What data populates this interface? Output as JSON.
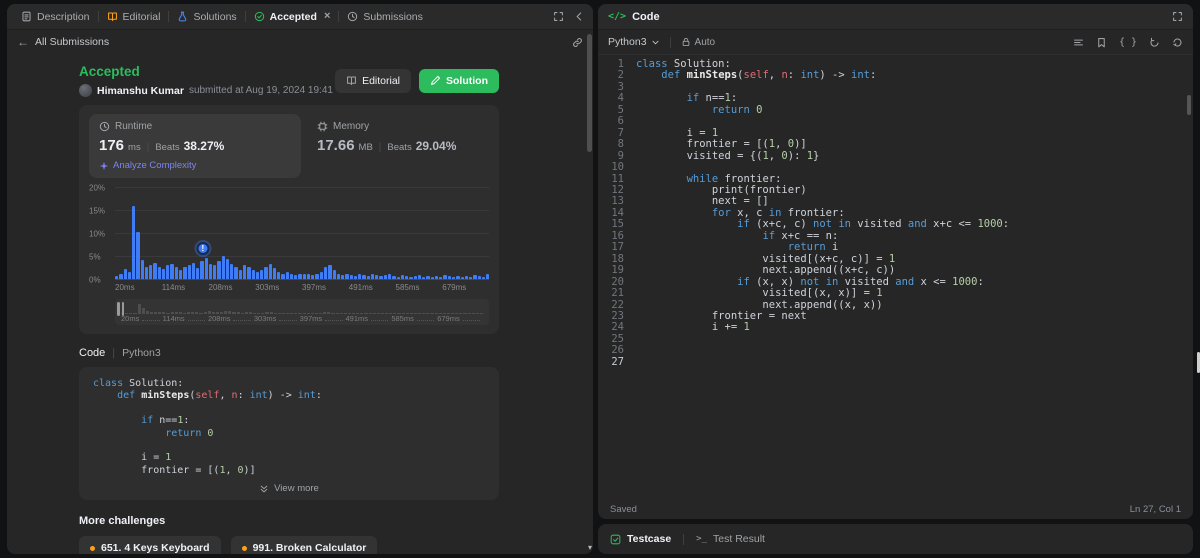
{
  "colors": {
    "accent_green": "#2cbb5d",
    "accent_blue": "#3f7cf6",
    "accent_orange": "#ffa116",
    "analyze_link": "#7c83f7",
    "panel_bg": "#262626"
  },
  "left_panel": {
    "tabs": [
      {
        "label": "Description"
      },
      {
        "label": "Editorial"
      },
      {
        "label": "Solutions"
      },
      {
        "label": "Accepted"
      },
      {
        "label": "Submissions"
      }
    ],
    "back_label": "All Submissions",
    "result": {
      "status": "Accepted",
      "author": "Himanshu Kumar",
      "submitted_at": "submitted at Aug 19, 2024 19:41",
      "editorial_button": "Editorial",
      "solution_button": "Solution"
    },
    "stats": {
      "runtime_label": "Runtime",
      "runtime_value": "176",
      "runtime_unit": "ms",
      "beats_label": "Beats",
      "runtime_beats": "38.27%",
      "analyze_link": "Analyze Complexity",
      "memory_label": "Memory",
      "memory_value": "17.66",
      "memory_unit": "MB",
      "memory_beats": "29.04%"
    },
    "code_section": {
      "label": "Code",
      "lang": "Python3",
      "view_more": "View more"
    },
    "preview_lines": [
      [
        [
          "k",
          "class"
        ],
        [
          "p",
          " Solution:"
        ]
      ],
      [
        [
          "p",
          "    "
        ],
        [
          "k",
          "def"
        ],
        [
          "p",
          " "
        ],
        [
          "d",
          "minSteps"
        ],
        [
          "p",
          "("
        ],
        [
          "s",
          "self"
        ],
        [
          "p",
          ", "
        ],
        [
          "s",
          "n"
        ],
        [
          "p",
          ": "
        ],
        [
          "k",
          "int"
        ],
        [
          "p",
          ") -> "
        ],
        [
          "k",
          "int"
        ],
        [
          "p",
          ":"
        ]
      ],
      [],
      [
        [
          "p",
          "        "
        ],
        [
          "k",
          "if"
        ],
        [
          "p",
          " n=="
        ],
        [
          "n",
          "1"
        ],
        [
          "p",
          ":"
        ]
      ],
      [
        [
          "p",
          "            "
        ],
        [
          "k",
          "return"
        ],
        [
          "p",
          " "
        ],
        [
          "n",
          "0"
        ]
      ],
      [],
      [
        [
          "p",
          "        i = "
        ],
        [
          "n",
          "1"
        ]
      ],
      [
        [
          "p",
          "        frontier = [("
        ],
        [
          "n",
          "1"
        ],
        [
          "p",
          ", "
        ],
        [
          "n",
          "0"
        ],
        [
          "p",
          ")]"
        ]
      ]
    ],
    "more_challenges": {
      "title": "More challenges",
      "items": [
        "651. 4 Keys Keyboard",
        "991. Broken Calculator"
      ]
    }
  },
  "chart_data": {
    "type": "bar",
    "title": "Runtime distribution: % of submissions per runtime bucket",
    "xlabel_ticks": [
      "20ms",
      "114ms",
      "208ms",
      "303ms",
      "397ms",
      "491ms",
      "585ms",
      "679ms"
    ],
    "ylabel_ticks": [
      "0%",
      "5%",
      "10%",
      "15%",
      "20%"
    ],
    "ylim": [
      0,
      20
    ],
    "values": [
      0.6,
      1.2,
      2.2,
      1.6,
      16,
      10.4,
      4.2,
      2.6,
      3,
      3.6,
      2.6,
      2.2,
      3,
      3.4,
      2.6,
      2,
      2.6,
      3,
      3.6,
      2.4,
      4,
      4.6,
      3.4,
      3,
      4,
      5,
      4.4,
      3.4,
      2.6,
      2,
      3,
      2.6,
      2,
      1.6,
      2,
      2.6,
      3.4,
      2.4,
      1.6,
      1,
      1.6,
      1,
      0.8,
      1,
      1.2,
      1,
      0.8,
      1.2,
      1.6,
      2.6,
      3,
      2,
      1.2,
      0.8,
      1,
      0.8,
      0.6,
      1,
      0.8,
      0.6,
      1,
      0.8,
      0.6,
      0.8,
      1,
      0.6,
      0.5,
      0.8,
      0.6,
      0.5,
      0.6,
      0.8,
      0.5,
      0.6,
      0.5,
      0.6,
      0.5,
      0.8,
      0.6,
      0.5,
      0.6,
      0.5,
      0.6,
      0.5,
      0.8,
      0.6,
      0.5,
      1
    ],
    "marker": {
      "x_percent": 23.5,
      "value": 4.6,
      "label": "!"
    }
  },
  "editor": {
    "header_title": "Code",
    "lang": "Python3",
    "auto_label": "Auto",
    "saved": "Saved",
    "cursor": "Ln 27, Col 1",
    "lines": [
      [
        [
          "k",
          "class"
        ],
        [
          "p",
          " Solution:"
        ]
      ],
      [
        [
          "p",
          "    "
        ],
        [
          "k",
          "def"
        ],
        [
          "p",
          " "
        ],
        [
          "d",
          "minSteps"
        ],
        [
          "p",
          "("
        ],
        [
          "s",
          "self"
        ],
        [
          "p",
          ", "
        ],
        [
          "s",
          "n"
        ],
        [
          "p",
          ": "
        ],
        [
          "k",
          "int"
        ],
        [
          "p",
          ") -> "
        ],
        [
          "k",
          "int"
        ],
        [
          "p",
          ":"
        ]
      ],
      [],
      [
        [
          "p",
          "        "
        ],
        [
          "k",
          "if"
        ],
        [
          "p",
          " n=="
        ],
        [
          "n",
          "1"
        ],
        [
          "p",
          ":"
        ]
      ],
      [
        [
          "p",
          "            "
        ],
        [
          "k",
          "return"
        ],
        [
          "p",
          " "
        ],
        [
          "n",
          "0"
        ]
      ],
      [],
      [
        [
          "p",
          "        i = "
        ],
        [
          "n",
          "1"
        ]
      ],
      [
        [
          "p",
          "        frontier = [("
        ],
        [
          "n",
          "1"
        ],
        [
          "p",
          ", "
        ],
        [
          "n",
          "0"
        ],
        [
          "p",
          ")]"
        ]
      ],
      [
        [
          "p",
          "        visited = {("
        ],
        [
          "n",
          "1"
        ],
        [
          "p",
          ", "
        ],
        [
          "n",
          "0"
        ],
        [
          "p",
          "): "
        ],
        [
          "n",
          "1"
        ],
        [
          "p",
          "}"
        ]
      ],
      [],
      [
        [
          "p",
          "        "
        ],
        [
          "k",
          "while"
        ],
        [
          "p",
          " frontier:"
        ]
      ],
      [
        [
          "p",
          "            print(frontier)"
        ]
      ],
      [
        [
          "p",
          "            next = []"
        ]
      ],
      [
        [
          "p",
          "            "
        ],
        [
          "k",
          "for"
        ],
        [
          "p",
          " x, c "
        ],
        [
          "k",
          "in"
        ],
        [
          "p",
          " frontier:"
        ]
      ],
      [
        [
          "p",
          "                "
        ],
        [
          "k",
          "if"
        ],
        [
          "p",
          " (x+c, c) "
        ],
        [
          "k",
          "not"
        ],
        [
          "p",
          " "
        ],
        [
          "k",
          "in"
        ],
        [
          "p",
          " visited "
        ],
        [
          "k",
          "and"
        ],
        [
          "p",
          " x+c <= "
        ],
        [
          "n",
          "1000"
        ],
        [
          "p",
          ":"
        ]
      ],
      [
        [
          "p",
          "                    "
        ],
        [
          "k",
          "if"
        ],
        [
          "p",
          " x+c == n:"
        ]
      ],
      [
        [
          "p",
          "                        "
        ],
        [
          "k",
          "return"
        ],
        [
          "p",
          " i"
        ]
      ],
      [
        [
          "p",
          "                    visited[(x+c, c)] = "
        ],
        [
          "n",
          "1"
        ]
      ],
      [
        [
          "p",
          "                    next.append((x+c, c))"
        ]
      ],
      [
        [
          "p",
          "                "
        ],
        [
          "k",
          "if"
        ],
        [
          "p",
          " (x, x) "
        ],
        [
          "k",
          "not"
        ],
        [
          "p",
          " "
        ],
        [
          "k",
          "in"
        ],
        [
          "p",
          " visited "
        ],
        [
          "k",
          "and"
        ],
        [
          "p",
          " x <= "
        ],
        [
          "n",
          "1000"
        ],
        [
          "p",
          ":"
        ]
      ],
      [
        [
          "p",
          "                    visited[(x, x)] = "
        ],
        [
          "n",
          "1"
        ]
      ],
      [
        [
          "p",
          "                    next.append((x, x))"
        ]
      ],
      [
        [
          "p",
          "            frontier = next"
        ]
      ],
      [
        [
          "p",
          "            i += "
        ],
        [
          "n",
          "1"
        ]
      ],
      [],
      [],
      []
    ]
  },
  "bottom_bar": {
    "testcase": "Testcase",
    "test_result": "Test Result"
  }
}
